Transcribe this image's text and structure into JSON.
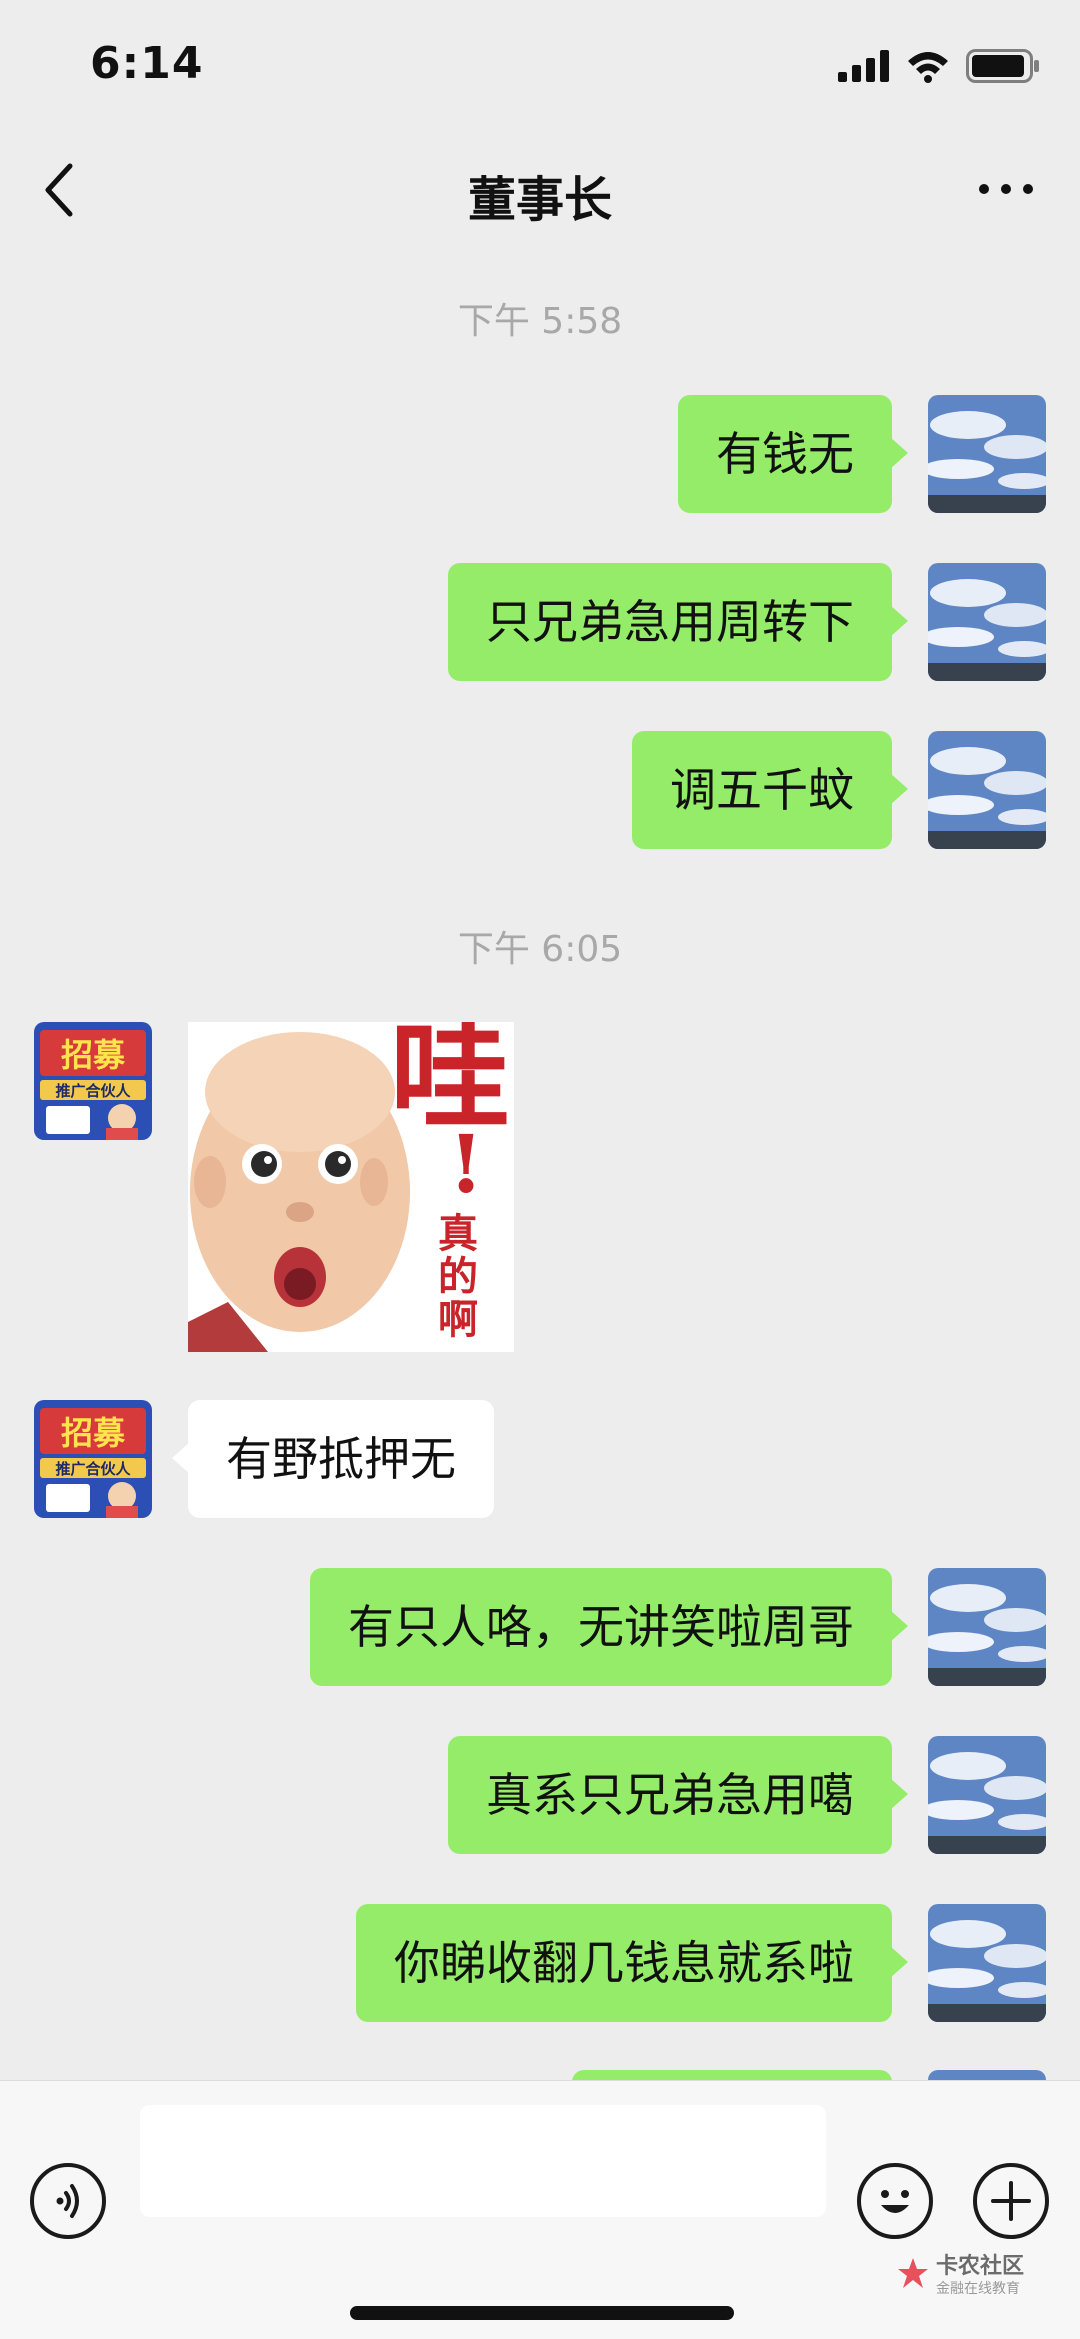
{
  "status_bar": {
    "time": "6:14",
    "icons": [
      "signal-icon",
      "wifi-icon",
      "battery-icon"
    ]
  },
  "nav": {
    "title": "董事长",
    "back_icon": "chevron-left-icon",
    "more_icon": "more-dots-icon"
  },
  "timestamps": {
    "first": "下午 5:58",
    "second": "下午 6:05"
  },
  "messages": {
    "m1": "有钱无",
    "m2": "只兄弟急用周转下",
    "m3": "调五千蚊",
    "m4": "有野抵押无",
    "m5": "有只人咯，无讲笑啦周哥",
    "m6": "真系只兄弟急用噶",
    "m7": "你睇收翻几钱息就系啦"
  },
  "sticker": {
    "big_char": "哇",
    "exclaim": "!",
    "side_text_1": "真",
    "side_text_2": "的",
    "side_text_3": "啊"
  },
  "contact_avatar": {
    "top_text": "招募",
    "sub_text": "推广合伙人"
  },
  "input_bar": {
    "placeholder": "",
    "voice_icon": "voice-icon",
    "emoji_icon": "emoji-icon",
    "plus_icon": "plus-icon"
  },
  "watermark": {
    "main": "卡农社区",
    "sub": "金融在线教育"
  },
  "colors": {
    "background": "#ededed",
    "self_bubble": "#95ec69",
    "other_bubble": "#ffffff",
    "timestamp": "#a8a8a8"
  }
}
